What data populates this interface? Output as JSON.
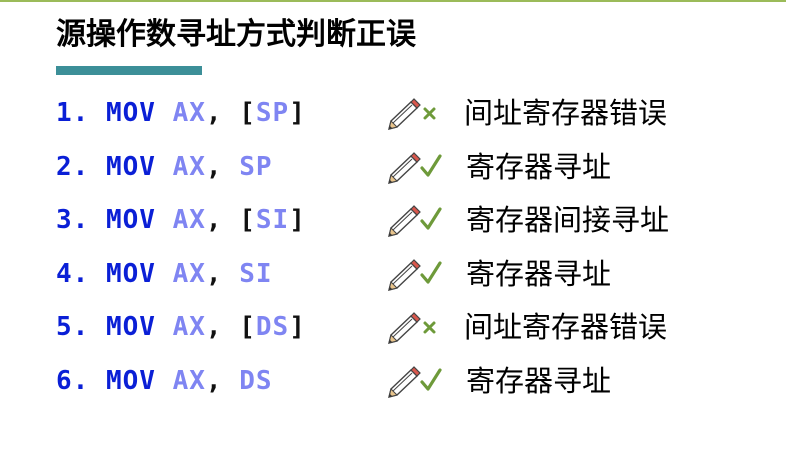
{
  "title": "源操作数寻址方式判断正误",
  "items": [
    {
      "num": "1.",
      "op": "MOV",
      "dst": "AX",
      "sep": ",",
      "src_open": "[",
      "src_reg": "SP",
      "src_close": "]",
      "result": "wrong",
      "verdict": "间址寄存器错误"
    },
    {
      "num": "2.",
      "op": "MOV",
      "dst": "AX",
      "sep": ",",
      "src_open": "",
      "src_reg": "SP",
      "src_close": "",
      "result": "correct",
      "verdict": "寄存器寻址"
    },
    {
      "num": "3.",
      "op": "MOV",
      "dst": "AX",
      "sep": ",",
      "src_open": "[",
      "src_reg": "SI",
      "src_close": "]",
      "result": "correct",
      "verdict": "寄存器间接寻址"
    },
    {
      "num": "4.",
      "op": "MOV",
      "dst": "AX",
      "sep": ",",
      "src_open": "",
      "src_reg": "SI",
      "src_close": "",
      "result": "correct",
      "verdict": "寄存器寻址"
    },
    {
      "num": "5.",
      "op": "MOV",
      "dst": "AX",
      "sep": ",",
      "src_open": "[",
      "src_reg": "DS",
      "src_close": "]",
      "result": "wrong",
      "verdict": "间址寄存器错误"
    },
    {
      "num": "6.",
      "op": "MOV",
      "dst": "AX",
      "sep": ",",
      "src_open": "",
      "src_reg": "DS",
      "src_close": "",
      "result": "correct",
      "verdict": "寄存器寻址"
    }
  ],
  "colors": {
    "top_rule": "#9bbb59",
    "accent_bar": "#3c8f98",
    "code": "#0a1fd6",
    "register": "#7f85f2",
    "check": "#6e9a3a",
    "cross": "#6e9a3a"
  },
  "icons": {
    "pencil": "pencil-icon",
    "correct": "check-icon",
    "wrong": "cross-icon"
  }
}
